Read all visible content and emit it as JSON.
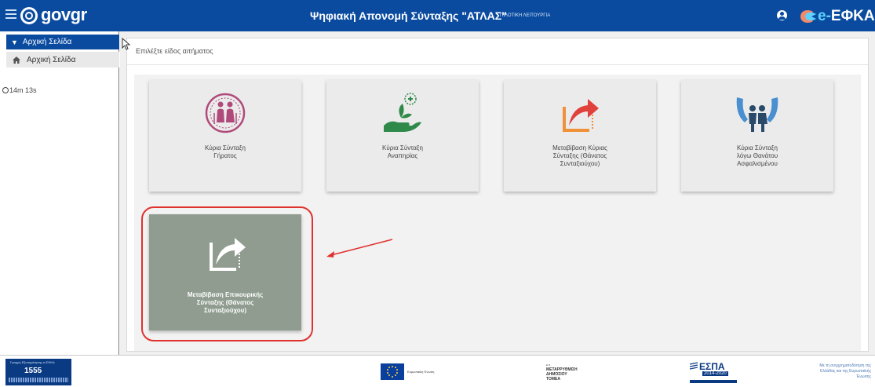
{
  "header": {
    "brand_gov": "gov",
    "brand_gr": "gr",
    "title": "Ψηφιακή Απονομή Σύνταξης \"ΑΤΛΑΣ\"",
    "badge": "ΠΙΛΟΤΙΚΗ ΛΕΙΤΟΥΡΓΙΑ",
    "efka_e": "e-",
    "efka_name": "ΕΦΚΑ"
  },
  "sidebar": {
    "section_label": "Αρχική Σελίδα",
    "item_label": "Αρχική Σελίδα",
    "timer": "14m 13s"
  },
  "main": {
    "panel_title": "Επιλέξτε είδος αιτήματος",
    "cards": [
      {
        "label": "Κύρια Σύνταξη\nΓήρατος",
        "icon": "elderly-couple-icon"
      },
      {
        "label": "Κύρια Σύνταξη\nΑναπηρίας",
        "icon": "hand-plant-medical-icon"
      },
      {
        "label": "Μεταβίβαση Κύριας\nΣύνταξης (Θάνατος\nΣυνταξιούχου)",
        "icon": "transfer-arrow-icon"
      },
      {
        "label": "Κύρια Σύνταξη\nλόγω Θανάτου\nΑσφαλισμένου",
        "icon": "children-protected-icon"
      },
      {
        "label": "Μεταβίβαση Επικουρικής\nΣύνταξης (Θάνατος\nΣυνταξιούχου)",
        "icon": "transfer-arrow-icon"
      }
    ]
  },
  "footer": {
    "helpline_top": "Γραμμή Εξυπηρέτησης e-ΕΦΚΑ",
    "helpline_number": "1555",
    "eu_text": "Ευρωπαϊκή Ένωση",
    "reform_line1": "Ε.Π.",
    "reform_line2": "ΜΕΤΑΡΡΥΘΜΙΣΗ",
    "reform_line3": "ΔΗΜΟΣΙΟΥ",
    "reform_line4": "ΤΟΜΕΑ",
    "espa_word": "ΕΣΠΑ",
    "espa_years": "2014-2020",
    "cofund_text": "Με τη συγχρηματοδότηση της Ελλάδας και της Ευρωπαϊκής Ένωσης"
  },
  "colors": {
    "header_blue": "#0a4ba0",
    "highlight_red": "#e0312d",
    "active_card": "#8f9c8f"
  }
}
